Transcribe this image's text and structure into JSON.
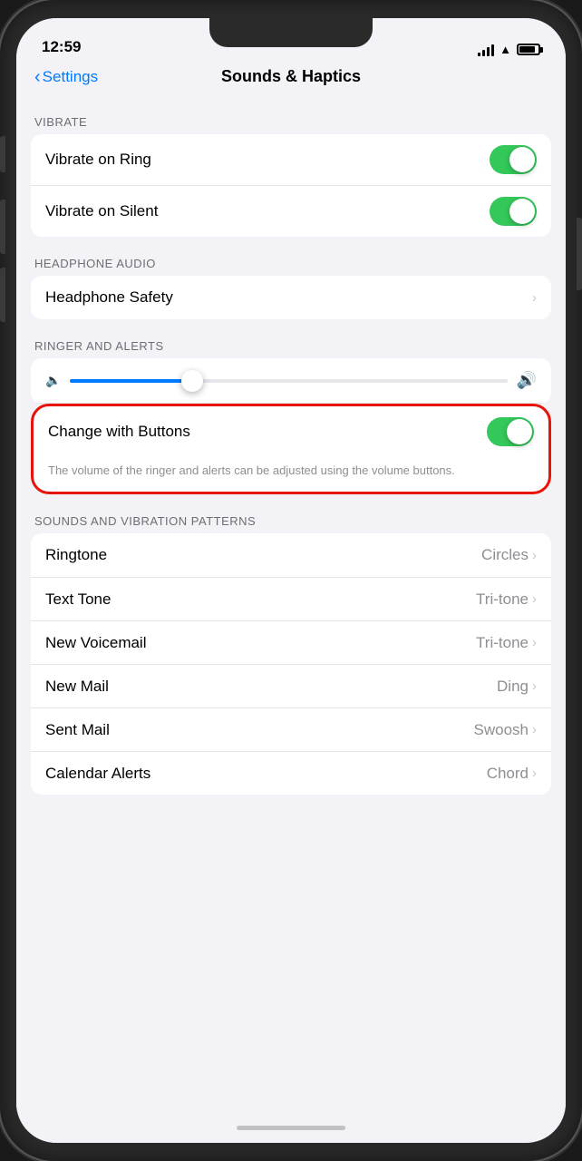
{
  "status": {
    "time": "12:59"
  },
  "nav": {
    "back_label": "Settings",
    "title": "Sounds & Haptics"
  },
  "vibrate_section": {
    "header": "VIBRATE",
    "vibrate_on_ring": {
      "label": "Vibrate on Ring",
      "enabled": true
    },
    "vibrate_on_silent": {
      "label": "Vibrate on Silent",
      "enabled": true
    }
  },
  "headphone_section": {
    "header": "HEADPHONE AUDIO",
    "headphone_safety": {
      "label": "Headphone Safety"
    }
  },
  "ringer_section": {
    "header": "RINGER AND ALERTS",
    "change_with_buttons": {
      "label": "Change with Buttons",
      "enabled": true
    },
    "description": "The volume of the ringer and alerts can be adjusted using the volume buttons."
  },
  "sounds_section": {
    "header": "SOUNDS AND VIBRATION PATTERNS",
    "items": [
      {
        "label": "Ringtone",
        "value": "Circles"
      },
      {
        "label": "Text Tone",
        "value": "Tri-tone"
      },
      {
        "label": "New Voicemail",
        "value": "Tri-tone"
      },
      {
        "label": "New Mail",
        "value": "Ding"
      },
      {
        "label": "Sent Mail",
        "value": "Swoosh"
      },
      {
        "label": "Calendar Alerts",
        "value": "Chord"
      }
    ]
  }
}
